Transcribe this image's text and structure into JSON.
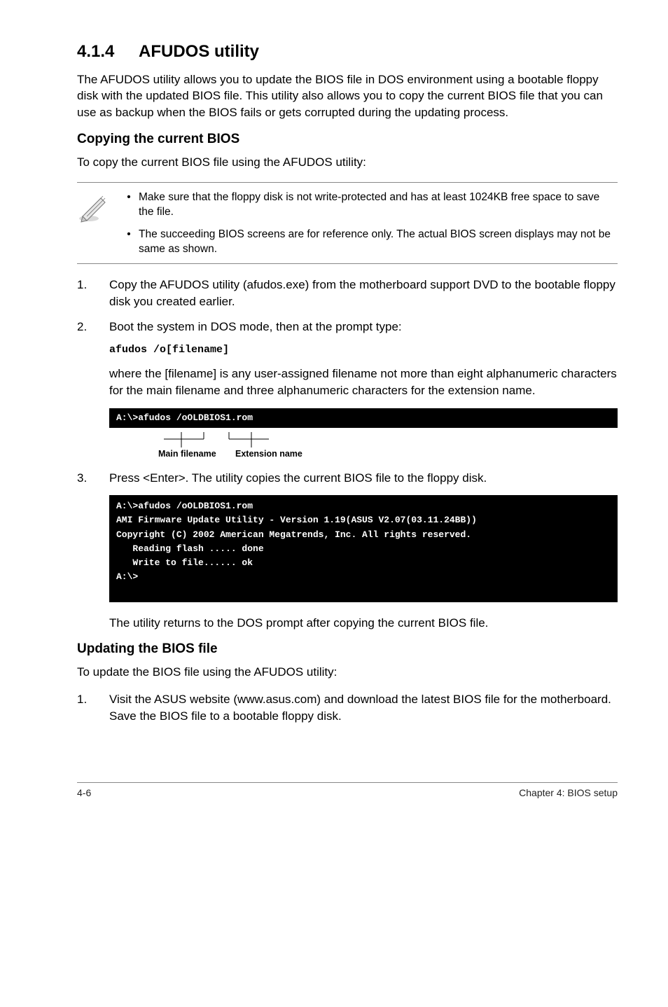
{
  "section": {
    "number": "4.1.4",
    "title": "AFUDOS utility"
  },
  "intro": "The AFUDOS utility allows you to update the BIOS file in DOS environment using a bootable floppy disk with the updated BIOS file. This utility also allows you to copy the current BIOS file that you can use as backup when the BIOS fails or gets corrupted during the updating process.",
  "copy": {
    "heading": "Copying the current BIOS",
    "lead": "To copy the current BIOS file using the AFUDOS utility:",
    "notes": [
      "Make sure that the floppy disk is not write-protected and has at least 1024KB free space to save the file.",
      "The succeeding BIOS screens are for reference only. The actual BIOS screen displays may not be same as shown."
    ],
    "steps": {
      "s1": "Copy the AFUDOS utility (afudos.exe) from the motherboard support DVD to the bootable floppy disk you created earlier.",
      "s2": "Boot the system in DOS mode, then at the prompt type:",
      "s2_code": "afudos /o[filename]",
      "s2_after": "where the [filename] is any user-assigned filename not more than eight alphanumeric characters  for the main filename and three alphanumeric characters for the extension name.",
      "s2_term": "A:\\>afudos /oOLDBIOS1.rom",
      "fn_main": "Main filename",
      "fn_ext": "Extension name",
      "s3": "Press <Enter>. The utility copies the current BIOS file to the floppy disk.",
      "s3_term": "A:\\>afudos /oOLDBIOS1.rom\nAMI Firmware Update Utility - Version 1.19(ASUS V2.07(03.11.24BB))\nCopyright (C) 2002 American Megatrends, Inc. All rights reserved.\n   Reading flash ..... done\n   Write to file...... ok\nA:\\>\n ",
      "s3_after": "The utility returns to the DOS prompt after copying the current BIOS file."
    }
  },
  "update": {
    "heading": "Updating the BIOS file",
    "lead": "To update the BIOS file using the AFUDOS utility:",
    "steps": {
      "s1": "Visit the ASUS website (www.asus.com) and download the latest BIOS file for the motherboard. Save the BIOS file to a bootable floppy disk."
    }
  },
  "footer": {
    "left": "4-6",
    "right": "Chapter 4: BIOS setup"
  }
}
